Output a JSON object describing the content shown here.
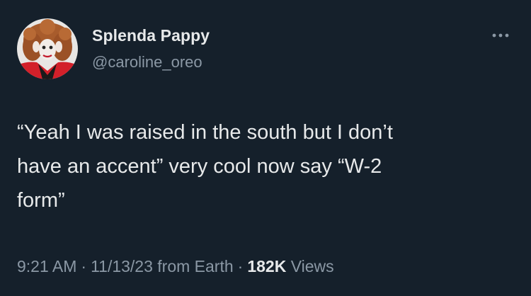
{
  "author": {
    "display_name": "Splenda Pappy",
    "handle": "@caroline_oreo",
    "avatar_icon": "user-avatar-photo"
  },
  "more_options_icon": "more-horizontal-icon",
  "tweet": {
    "text_lines": [
      "“Yeah I was raised in the south but I don’t",
      "have an accent” very cool now say “W-2",
      "form”"
    ]
  },
  "meta": {
    "time": "9:21 AM",
    "separator": "·",
    "date": "11/13/23",
    "source": "from Earth",
    "views_count": "182K",
    "views_label": "Views"
  },
  "colors": {
    "background": "#15202b",
    "primary_text": "#e7e9ea",
    "secondary_text": "#8b98a5"
  }
}
